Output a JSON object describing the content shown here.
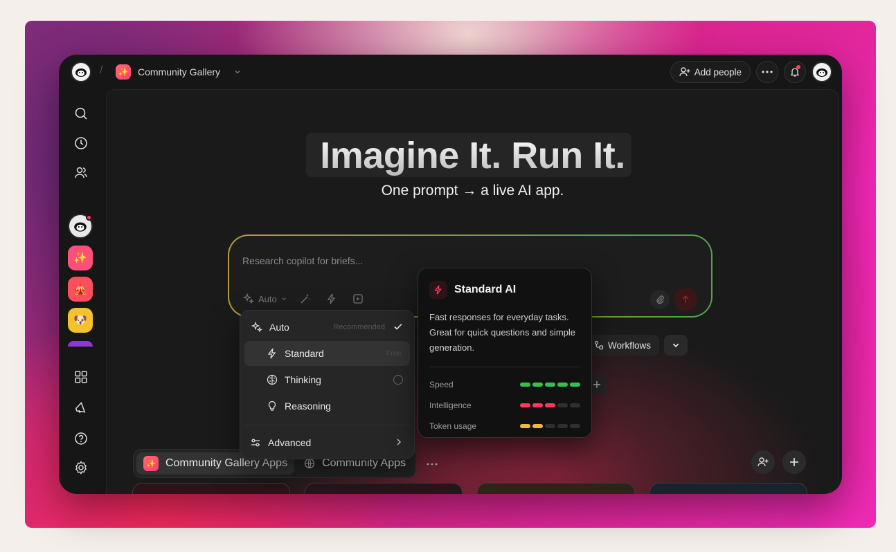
{
  "topbar": {
    "breadcrumb_label": "Community Gallery",
    "app_badge_glyph": "✨",
    "add_people_label": "Add people"
  },
  "hero": {
    "title": "Imagine It. Run It.",
    "subtitle": "One prompt → a live AI app."
  },
  "prompt": {
    "placeholder": "Research copilot for briefs...",
    "model_label": "Auto"
  },
  "sidebar": {
    "apps": [
      {
        "glyph": "🐑",
        "bg": "#e9e9e9"
      },
      {
        "glyph": "✨",
        "bg": "#ff4f7a"
      },
      {
        "glyph": "🎪",
        "bg": "#ff4f5e"
      },
      {
        "glyph": "🐶",
        "bg": "#f3c22e"
      }
    ]
  },
  "model_menu": {
    "items": [
      {
        "label": "Auto",
        "hint": "Recommended"
      },
      {
        "label": "Standard",
        "hint": "Free"
      },
      {
        "label": "Thinking",
        "hint": ""
      },
      {
        "label": "Reasoning",
        "hint": ""
      }
    ],
    "advanced_label": "Advanced"
  },
  "info_card": {
    "title": "Standard AI",
    "description": "Fast responses for everyday tasks. Great for quick questions and simple generation.",
    "metrics": [
      {
        "label": "Speed",
        "level": 5,
        "color": "#35c04f"
      },
      {
        "label": "Intelligence",
        "level": 3,
        "color": "#ff3b5c"
      },
      {
        "label": "Token usage",
        "level": 2,
        "color": "#f4b63f"
      }
    ]
  },
  "chips": {
    "workflows_label": "Workflows"
  },
  "bottom_tabs": {
    "active_label": "Community Gallery Apps",
    "second_label": "Community Apps"
  }
}
